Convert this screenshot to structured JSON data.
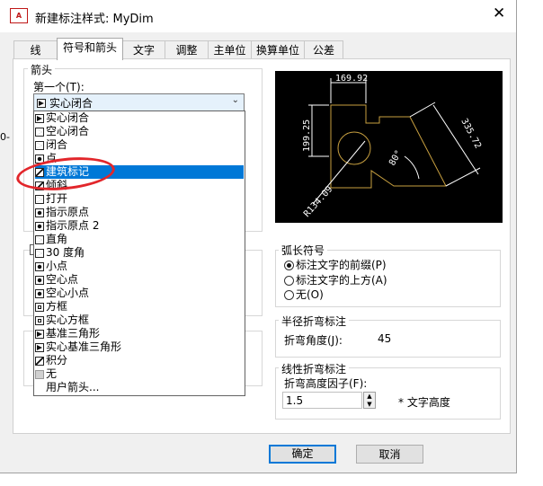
{
  "window": {
    "title": "新建标注样式: MyDim",
    "app_icon_text": "A",
    "close_glyph": "✕"
  },
  "tabs": [
    "线",
    "符号和箭头",
    "文字",
    "调整",
    "主单位",
    "换算单位",
    "公差"
  ],
  "arrows": {
    "group_label": "箭头",
    "first_label": "第一个(T):",
    "selected_value": "实心闭合",
    "options": [
      {
        "label": "实心闭合",
        "icon": "solid-closed-arrow-icon"
      },
      {
        "label": "空心闭合",
        "icon": "hollow-closed-arrow-icon"
      },
      {
        "label": "闭合",
        "icon": "closed-arrow-icon"
      },
      {
        "label": "点",
        "icon": "dot-arrow-icon"
      },
      {
        "label": "建筑标记",
        "icon": "architectural-tick-icon"
      },
      {
        "label": "倾斜",
        "icon": "oblique-icon"
      },
      {
        "label": "打开",
        "icon": "open-arrow-icon"
      },
      {
        "label": "指示原点",
        "icon": "origin-indicator-icon"
      },
      {
        "label": "指示原点 2",
        "icon": "origin-indicator-2-icon"
      },
      {
        "label": "直角",
        "icon": "right-angle-icon"
      },
      {
        "label": "30 度角",
        "icon": "open-30-icon"
      },
      {
        "label": "小点",
        "icon": "dot-small-icon"
      },
      {
        "label": "空心点",
        "icon": "dot-blank-icon"
      },
      {
        "label": "空心小点",
        "icon": "dot-small-blank-icon"
      },
      {
        "label": "方框",
        "icon": "box-blank-icon"
      },
      {
        "label": "实心方框",
        "icon": "box-filled-icon"
      },
      {
        "label": "基准三角形",
        "icon": "datum-blank-icon"
      },
      {
        "label": "实心基准三角形",
        "icon": "datum-filled-icon"
      },
      {
        "label": "积分",
        "icon": "integral-icon"
      },
      {
        "label": "无",
        "icon": "none-icon"
      },
      {
        "label": "用户箭头...",
        "icon": ""
      }
    ],
    "highlighted_index": 4
  },
  "preview": {
    "dim_top": "169.92",
    "dim_left": "199.25",
    "dim_right": "335.72",
    "dim_angle": "80°",
    "dim_radius": "R134.09"
  },
  "arc_length": {
    "group_label": "弧长符号",
    "options": [
      "标注文字的前缀(P)",
      "标注文字的上方(A)",
      "无(O)"
    ],
    "selected_index": 0
  },
  "radius_jog": {
    "group_label": "半径折弯标注",
    "angle_label": "折弯角度(J):",
    "angle_value": "45"
  },
  "linear_jog": {
    "group_label": "线性折弯标注",
    "factor_label": "折弯高度因子(F):",
    "factor_value": "1.5",
    "suffix": "* 文字高度"
  },
  "buttons": {
    "ok": "确定",
    "cancel": "取消"
  },
  "background_fragment": "0-",
  "colors": {
    "selection": "#0078d7",
    "annotation_red": "#e2262b",
    "preview_geometry": "#c8a040",
    "preview_dims": "#ffffff"
  }
}
